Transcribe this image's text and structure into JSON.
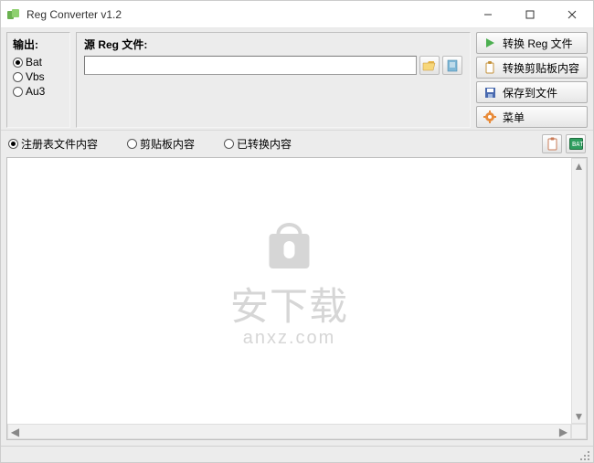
{
  "window": {
    "title": "Reg Converter v1.2"
  },
  "output": {
    "label": "输出:",
    "options": [
      {
        "value": "Bat",
        "checked": true
      },
      {
        "value": "Vbs",
        "checked": false
      },
      {
        "value": "Au3",
        "checked": false
      }
    ]
  },
  "source": {
    "label": "源 Reg 文件:",
    "value": "",
    "placeholder": ""
  },
  "actions": {
    "convert_reg": "转换 Reg 文件",
    "convert_clipboard": "转换剪贴板内容",
    "save_to_file": "保存到文件",
    "menu": "菜单"
  },
  "view_tabs": {
    "reg_content": "注册表文件内容",
    "clipboard_content": "剪贴板内容",
    "converted_content": "已转换内容",
    "selected": "reg_content"
  },
  "watermark": {
    "main": "安下载",
    "sub": "anxz.com"
  },
  "icons": {
    "browse": "browse-folder-icon",
    "clear": "clear-icon",
    "copy": "copy-icon",
    "run": "run-bat-icon"
  }
}
